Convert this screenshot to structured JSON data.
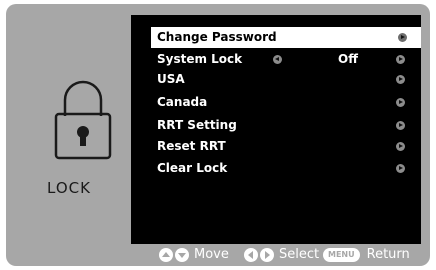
{
  "left": {
    "title": "LOCK",
    "icon": "padlock-icon"
  },
  "menu": {
    "items": [
      {
        "label": "Change Password",
        "selected": true
      },
      {
        "label": "System Lock",
        "value": "Off"
      },
      {
        "label": "USA"
      },
      {
        "label": "Canada"
      },
      {
        "label": "RRT Setting"
      },
      {
        "label": "Reset RRT"
      },
      {
        "label": "Clear Lock"
      }
    ]
  },
  "footer": {
    "move": "Move",
    "select": "Select",
    "menu_key": "MENU",
    "return": "Return"
  },
  "colors": {
    "frame": "#a7a7a7",
    "menu_bg": "#000000",
    "selected_bg": "#ffffff"
  }
}
